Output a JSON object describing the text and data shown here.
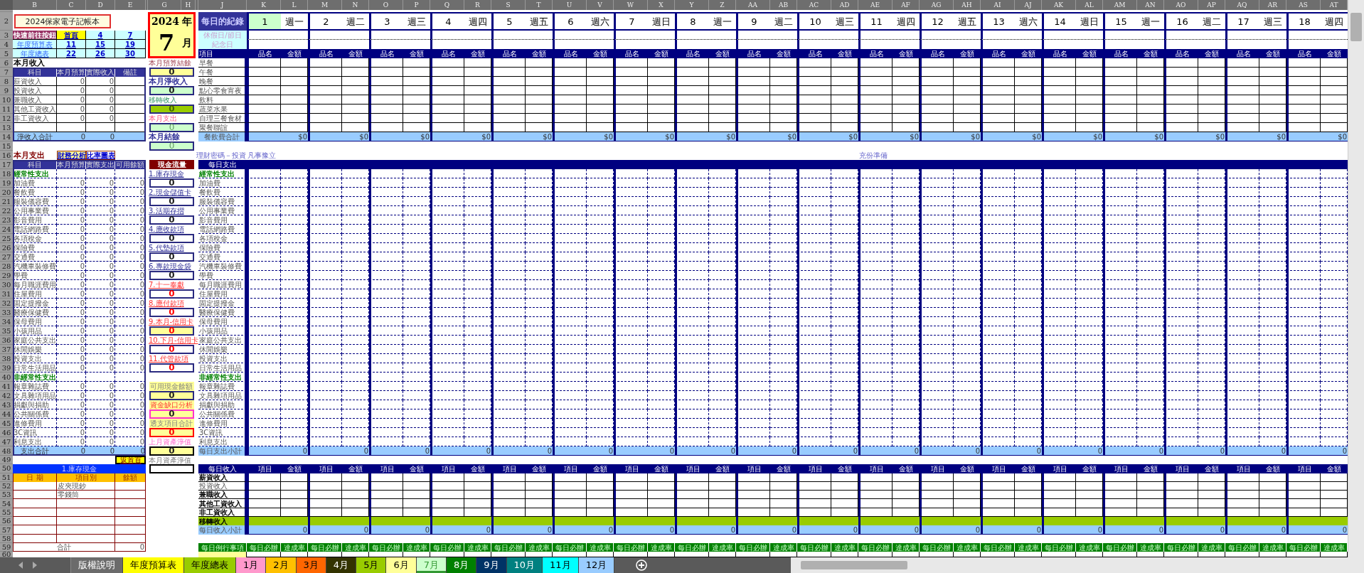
{
  "column_headers": [
    "B",
    "C",
    "D",
    "E",
    "G",
    "H",
    "J",
    "K",
    "L",
    "M",
    "N",
    "O",
    "P",
    "Q",
    "R",
    "S",
    "T",
    "U",
    "V",
    "W",
    "X",
    "Y",
    "Z",
    "AA",
    "AB",
    "AC",
    "AD",
    "AE",
    "AF",
    "AG",
    "AH",
    "AI",
    "AJ",
    "AK",
    "AL",
    "AM",
    "AN",
    "AO",
    "AP",
    "AQ",
    "AR",
    "AS",
    "AT"
  ],
  "row_headers": [
    "2",
    "3",
    "4",
    "5",
    "6",
    "7",
    "8",
    "9",
    "10",
    "11",
    "12",
    "13",
    "14",
    "15",
    "16",
    "17",
    "18",
    "19",
    "20",
    "21",
    "22",
    "23",
    "24",
    "25",
    "26",
    "27",
    "28",
    "29",
    "30",
    "31",
    "32",
    "33",
    "34",
    "35",
    "36",
    "37",
    "38",
    "39",
    "40",
    "41",
    "42",
    "43",
    "44",
    "45",
    "46",
    "47",
    "48",
    "49",
    "50",
    "51",
    "52",
    "53",
    "54",
    "55",
    "56",
    "57",
    "58",
    "59",
    "60"
  ],
  "title": "2024保家電子記帳本",
  "quick_nav": {
    "rows": [
      {
        "label": "快速前往按鈕",
        "kind": "label",
        "links": [
          {
            "text": "首頁",
            "highlighted": true
          },
          {
            "text": "4",
            "highlighted": false
          },
          {
            "text": "7",
            "highlighted": false
          }
        ]
      },
      {
        "label": "年度預算表",
        "kind": "link",
        "links": [
          {
            "text": "11",
            "highlighted": false
          },
          {
            "text": "15",
            "highlighted": false
          },
          {
            "text": "19",
            "highlighted": false
          }
        ]
      },
      {
        "label": "年度總表",
        "kind": "link",
        "links": [
          {
            "text": "22",
            "highlighted": false
          },
          {
            "text": "26",
            "highlighted": false
          },
          {
            "text": "30",
            "highlighted": false
          }
        ]
      }
    ]
  },
  "income": {
    "heading": "本月收入",
    "columns": [
      "科目",
      "本月預算",
      "實際收入",
      "備註"
    ],
    "rows": [
      {
        "item": "薪資收入",
        "budget": "0",
        "actual": "0"
      },
      {
        "item": "投資收入",
        "budget": "0",
        "actual": "0"
      },
      {
        "item": "兼職收入",
        "budget": "0",
        "actual": "0"
      },
      {
        "item": "其他工資收入",
        "budget": "0",
        "actual": "0"
      },
      {
        "item": "非工資收入",
        "budget": "0",
        "actual": "0"
      }
    ],
    "total": {
      "label": "淨收入合計",
      "budget": "0",
      "actual": "0"
    }
  },
  "expense": {
    "heading": "本月支出",
    "buttons": [
      {
        "text": "財務分析",
        "highlighted": true
      },
      {
        "text": "比率圖表",
        "highlighted": false
      }
    ],
    "columns": [
      "科目",
      "本月預算",
      "實際支出",
      "可用餘額"
    ],
    "groups": [
      {
        "label": "經常性支出",
        "items": [
          {
            "name": "加油費",
            "budget": "0",
            "actual": "0",
            "remaining": "0"
          },
          {
            "name": "餐飲費",
            "budget": "0",
            "actual": "0",
            "remaining": "0"
          },
          {
            "name": "服裝儀容費",
            "budget": "0",
            "actual": "0",
            "remaining": "0"
          },
          {
            "name": "公用事業費",
            "budget": "0",
            "actual": "0",
            "remaining": "0"
          },
          {
            "name": "影音費用",
            "budget": "0",
            "actual": "0",
            "remaining": "0"
          },
          {
            "name": "電話網路費",
            "budget": "0",
            "actual": "0",
            "remaining": "0"
          },
          {
            "name": "各項稅金",
            "budget": "0",
            "actual": "0",
            "remaining": "0"
          },
          {
            "name": "保險費",
            "budget": "0",
            "actual": "0",
            "remaining": "0"
          },
          {
            "name": "交通費",
            "budget": "0",
            "actual": "0",
            "remaining": "0"
          },
          {
            "name": "汽機車裝修費",
            "budget": "0",
            "actual": "0",
            "remaining": "0"
          },
          {
            "name": "學費",
            "budget": "0",
            "actual": "0",
            "remaining": "0"
          },
          {
            "name": "每月職涯費用",
            "budget": "0",
            "actual": "0",
            "remaining": "0"
          },
          {
            "name": "住屋費用",
            "budget": "0",
            "actual": "0",
            "remaining": "0"
          },
          {
            "name": "固定提撥金",
            "budget": "0",
            "actual": "0",
            "remaining": "0"
          },
          {
            "name": "醫療保健費",
            "budget": "0",
            "actual": "0",
            "remaining": "0"
          },
          {
            "name": "保母費用",
            "budget": "0",
            "actual": "0",
            "remaining": "0"
          },
          {
            "name": "小孩用品",
            "budget": "0",
            "actual": "0",
            "remaining": "0"
          },
          {
            "name": "家庭公共支出",
            "budget": "0",
            "actual": "0",
            "remaining": "0"
          },
          {
            "name": "休閒娛樂",
            "budget": "0",
            "actual": "0",
            "remaining": "0"
          },
          {
            "name": "投資支出",
            "budget": "0",
            "actual": "0",
            "remaining": "0"
          },
          {
            "name": "日常生活用品",
            "budget": "0",
            "actual": "0",
            "remaining": "0"
          }
        ]
      },
      {
        "label": "非經常性支出",
        "items": [
          {
            "name": "報章雜誌費",
            "budget": "0",
            "actual": "0",
            "remaining": "0"
          },
          {
            "name": "文具雜項用品",
            "budget": "0",
            "actual": "0",
            "remaining": "0"
          },
          {
            "name": "捐獻與捐助",
            "budget": "0",
            "actual": "0",
            "remaining": "0"
          },
          {
            "name": "公共關係費",
            "budget": "0",
            "actual": "0",
            "remaining": "0"
          },
          {
            "name": "進修費用",
            "budget": "0",
            "actual": "0",
            "remaining": "0"
          },
          {
            "name": "3C資訊",
            "budget": "0",
            "actual": "0",
            "remaining": "0"
          },
          {
            "name": "利息支出",
            "budget": "0",
            "actual": "0",
            "remaining": "0"
          }
        ]
      }
    ],
    "total": {
      "label": "支出合計",
      "budget": "0",
      "actual": "0",
      "remaining": "0"
    }
  },
  "home_button": "返首頁",
  "cash_table": {
    "title": "1.庫存現金",
    "columns": [
      "日 期",
      "項目別",
      "餘額"
    ],
    "rows": [
      {
        "item": "皮夾現鈔"
      },
      {
        "item": "零錢筒"
      }
    ],
    "total_label": "合計",
    "total": "0"
  },
  "date_box": {
    "year": "2024",
    "year_unit": "年",
    "month": "7",
    "month_unit": "月"
  },
  "summary": [
    {
      "label": "本月預算結餘",
      "value": "0",
      "kind": "budget"
    },
    {
      "label": "本月淨收入",
      "value": "0",
      "kind": "income"
    },
    {
      "label": "移轉收入",
      "value": "0",
      "kind": "transfer"
    },
    {
      "label": "本月支出",
      "value": "0",
      "kind": "expense"
    },
    {
      "label": "本月結餘",
      "value": "0",
      "kind": "balance"
    }
  ],
  "cash_flow": {
    "heading": "現金流量",
    "items": [
      {
        "label": "1.庫存現金",
        "value": "0",
        "kind": "asset"
      },
      {
        "label": "2.現金儲值卡",
        "value": "0",
        "kind": "asset"
      },
      {
        "label": "3.活期存摺",
        "value": "0",
        "kind": "asset"
      },
      {
        "label": "4.應收款項",
        "value": "0",
        "kind": "asset"
      },
      {
        "label": "5.代墊款項",
        "value": "0",
        "kind": "asset"
      },
      {
        "label": "6.專款現金袋",
        "value": "0",
        "kind": "asset"
      },
      {
        "label": "7.十一奉獻",
        "value": "0",
        "kind": "liability"
      },
      {
        "label": "8.應付款項",
        "value": "0",
        "kind": "liability"
      },
      {
        "label": "9.本月-信用卡",
        "value": "0",
        "kind": "credit"
      },
      {
        "label": "10.下月-信用卡",
        "value": "0",
        "kind": "liability"
      },
      {
        "label": "11.代管款項",
        "value": "0",
        "kind": "liability"
      }
    ]
  },
  "analysis": [
    {
      "label": "可用現金餘額",
      "value": "0",
      "kind": "available"
    },
    {
      "label": "資金缺口分析",
      "value": "0",
      "kind": "gap"
    },
    {
      "label": "透支項目合計",
      "value": "0",
      "kind": "overdraft"
    },
    {
      "label": "上月資產淨值",
      "value": "0",
      "kind": "last"
    },
    {
      "label": "本月資產淨值",
      "kind": "current"
    }
  ],
  "daily": {
    "heading": "每日的紀錄",
    "holiday_label": "休假日/節日",
    "anniversary_label": "紀念日",
    "meal_header": "項目",
    "meal_items": [
      "早餐",
      "午餐",
      "晚餐",
      "點心零食宵夜",
      "飲料",
      "蔬菜水果",
      "自理三餐食材",
      "聚餐聯誼"
    ],
    "meal_total": "餐飲費合計",
    "note": "理財密碼－投資",
    "expense_header": "每日支出",
    "expense_groups": [
      {
        "label": "經常性支出",
        "items": [
          "加油費",
          "餐飲費",
          "服裝儀容費",
          "公用事業費",
          "影音費用",
          "電話網路費",
          "各項稅金",
          "保險費",
          "交通費",
          "汽機車裝修費",
          "學費",
          "每月職涯費用",
          "住屋費用",
          "固定提撥金",
          "醫療保健費",
          "保母費用",
          "小孩用品",
          "家庭公共支出",
          "休閒娛樂",
          "投資支出",
          "日常生活用品"
        ]
      },
      {
        "label": "非經常性支出",
        "items": [
          "報章雜誌費",
          "文具雜項用品",
          "捐獻與捐助",
          "公共關係費",
          "進修費用",
          "3C資訊",
          "利息支出"
        ]
      }
    ],
    "expense_total": "每日支出小計",
    "income_header": "每日收入",
    "income_items": [
      {
        "name": "薪資收入",
        "kind": "bold"
      },
      {
        "name": "投資收入",
        "kind": "plain"
      },
      {
        "name": "兼職收入",
        "kind": "bold"
      },
      {
        "name": "其他工資收入",
        "kind": "bold"
      },
      {
        "name": "非工資收入",
        "kind": "bold"
      }
    ],
    "transfer_label": "移轉收入",
    "income_total": "每日收入小計",
    "routine_header": "每日例行事項"
  },
  "days": [
    {
      "date": "1",
      "weekday": "週一",
      "highlighted": true,
      "note": "凡事豫立",
      "item_header": "品名",
      "amount_header": "金額",
      "meal_total": "$0",
      "expense_total": "0",
      "income_item_header": "項目",
      "income_amount_header": "金額",
      "income_total": "0",
      "routine_header": "每日必辦",
      "rate_header": "達成率"
    },
    {
      "date": "2",
      "weekday": "週二",
      "highlighted": false,
      "item_header": "品名",
      "amount_header": "金額",
      "meal_total": "$0",
      "expense_total": "0",
      "income_item_header": "項目",
      "income_amount_header": "金額",
      "income_total": "0",
      "routine_header": "每日必辦",
      "rate_header": "達成率"
    },
    {
      "date": "3",
      "weekday": "週三",
      "highlighted": false,
      "item_header": "品名",
      "amount_header": "金額",
      "meal_total": "$0",
      "expense_total": "0",
      "income_item_header": "項目",
      "income_amount_header": "金額",
      "income_total": "0",
      "routine_header": "每日必辦",
      "rate_header": "達成率"
    },
    {
      "date": "4",
      "weekday": "週四",
      "highlighted": false,
      "item_header": "品名",
      "amount_header": "金額",
      "meal_total": "$0",
      "expense_total": "0",
      "income_item_header": "項目",
      "income_amount_header": "金額",
      "income_total": "0",
      "routine_header": "每日必辦",
      "rate_header": "達成率"
    },
    {
      "date": "5",
      "weekday": "週五",
      "highlighted": false,
      "item_header": "品名",
      "amount_header": "金額",
      "meal_total": "$0",
      "expense_total": "0",
      "income_item_header": "項目",
      "income_amount_header": "金額",
      "income_total": "0",
      "routine_header": "每日必辦",
      "rate_header": "達成率"
    },
    {
      "date": "6",
      "weekday": "週六",
      "highlighted": false,
      "item_header": "品名",
      "amount_header": "金額",
      "meal_total": "$0",
      "expense_total": "0",
      "income_item_header": "項目",
      "income_amount_header": "金額",
      "income_total": "0",
      "routine_header": "每日必辦",
      "rate_header": "達成率"
    },
    {
      "date": "7",
      "weekday": "週日",
      "highlighted": false,
      "item_header": "品名",
      "amount_header": "金額",
      "meal_total": "$0",
      "expense_total": "0",
      "income_item_header": "項目",
      "income_amount_header": "金額",
      "income_total": "0",
      "routine_header": "每日必辦",
      "rate_header": "達成率"
    },
    {
      "date": "8",
      "weekday": "週一",
      "highlighted": false,
      "item_header": "品名",
      "amount_header": "金額",
      "meal_total": "$0",
      "expense_total": "0",
      "income_item_header": "項目",
      "income_amount_header": "金額",
      "income_total": "0",
      "routine_header": "每日必辦",
      "rate_header": "達成率"
    },
    {
      "date": "9",
      "weekday": "週二",
      "highlighted": false,
      "item_header": "品名",
      "amount_header": "金額",
      "meal_total": "$0",
      "expense_total": "0",
      "income_item_header": "項目",
      "income_amount_header": "金額",
      "income_total": "0",
      "routine_header": "每日必辦",
      "rate_header": "達成率"
    },
    {
      "date": "10",
      "weekday": "週三",
      "highlighted": false,
      "item_header": "品名",
      "amount_header": "金額",
      "meal_total": "$0",
      "expense_total": "0",
      "income_item_header": "項目",
      "income_amount_header": "金額",
      "income_total": "0",
      "routine_header": "每日必辦",
      "rate_header": "達成率"
    },
    {
      "date": "11",
      "weekday": "週四",
      "highlighted": false,
      "note": "充份準備",
      "item_header": "品名",
      "amount_header": "金額",
      "meal_total": "$0",
      "expense_total": "0",
      "income_item_header": "項目",
      "income_amount_header": "金額",
      "income_total": "0",
      "routine_header": "每日必辦",
      "rate_header": "達成率"
    },
    {
      "date": "12",
      "weekday": "週五",
      "highlighted": false,
      "item_header": "品名",
      "amount_header": "金額",
      "meal_total": "$0",
      "expense_total": "0",
      "income_item_header": "項目",
      "income_amount_header": "金額",
      "income_total": "0",
      "routine_header": "每日必辦",
      "rate_header": "達成率"
    },
    {
      "date": "13",
      "weekday": "週六",
      "highlighted": false,
      "item_header": "品名",
      "amount_header": "金額",
      "meal_total": "$0",
      "expense_total": "0",
      "income_item_header": "項目",
      "income_amount_header": "金額",
      "income_total": "0",
      "routine_header": "每日必辦",
      "rate_header": "達成率"
    },
    {
      "date": "14",
      "weekday": "週日",
      "highlighted": false,
      "item_header": "品名",
      "amount_header": "金額",
      "meal_total": "$0",
      "expense_total": "0",
      "income_item_header": "項目",
      "income_amount_header": "金額",
      "income_total": "0",
      "routine_header": "每日必辦",
      "rate_header": "達成率"
    },
    {
      "date": "15",
      "weekday": "週一",
      "highlighted": false,
      "item_header": "品名",
      "amount_header": "金額",
      "meal_total": "$0",
      "expense_total": "0",
      "income_item_header": "項目",
      "income_amount_header": "金額",
      "income_total": "0",
      "routine_header": "每日必辦",
      "rate_header": "達成率"
    },
    {
      "date": "16",
      "weekday": "週二",
      "highlighted": false,
      "item_header": "品名",
      "amount_header": "金額",
      "meal_total": "$0",
      "expense_total": "0",
      "income_item_header": "項目",
      "income_amount_header": "金額",
      "income_total": "0",
      "routine_header": "每日必辦",
      "rate_header": "達成率"
    },
    {
      "date": "17",
      "weekday": "週三",
      "highlighted": false,
      "item_header": "品名",
      "amount_header": "金額",
      "meal_total": "$0",
      "expense_total": "0",
      "income_item_header": "項目",
      "income_amount_header": "金額",
      "income_total": "0",
      "routine_header": "每日必辦",
      "rate_header": "達成率"
    },
    {
      "date": "18",
      "weekday": "週四",
      "highlighted": false,
      "item_header": "品名",
      "amount_header": "金額",
      "meal_total": "$0",
      "expense_total": "0",
      "income_item_header": "項目",
      "income_amount_header": "金額",
      "income_total": "0",
      "routine_header": "每日必辦",
      "rate_header": "達成率"
    }
  ],
  "tabs": [
    {
      "label": "版權說明",
      "color": "#6b6b6b",
      "selected": false
    },
    {
      "label": "年度預算表",
      "color": "#ffff00",
      "selected": false
    },
    {
      "label": "年度總表",
      "color": "#99cc00",
      "selected": false
    },
    {
      "label": "1月",
      "color": "#ff99cc",
      "selected": false
    },
    {
      "label": "2月",
      "color": "#ffc000",
      "selected": false
    },
    {
      "label": "3月",
      "color": "#ff6600",
      "selected": false
    },
    {
      "label": "4月",
      "color": "#333300",
      "selected": false
    },
    {
      "label": "5月",
      "color": "#99cc00",
      "selected": false
    },
    {
      "label": "6月",
      "color": "#ffff99",
      "selected": false
    },
    {
      "label": "7月",
      "color": "#ccffcc",
      "selected": true
    },
    {
      "label": "8月",
      "color": "#008000",
      "selected": false
    },
    {
      "label": "9月",
      "color": "#003366",
      "selected": false
    },
    {
      "label": "10月",
      "color": "#008080",
      "selected": false
    },
    {
      "label": "11月",
      "color": "#00ffff",
      "selected": false
    },
    {
      "label": "12月",
      "color": "#99ccff",
      "selected": false
    }
  ]
}
